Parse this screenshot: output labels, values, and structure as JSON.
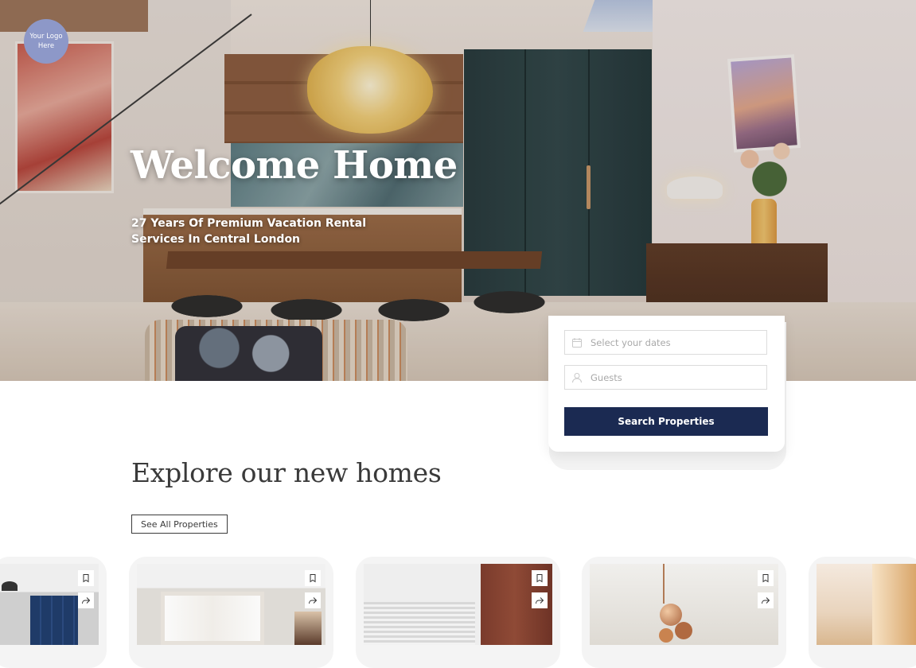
{
  "logo": {
    "line1": "Your Logo",
    "line2": "Here"
  },
  "hero": {
    "title": "Welcome Home",
    "subtitle": "27 Years Of Premium Vacation Rental Services In Central London"
  },
  "search": {
    "dates_placeholder": "Select your dates",
    "guests_placeholder": "Guests",
    "button_label": "Search Properties",
    "button_color": "#1b2a52"
  },
  "explore": {
    "title": "Explore our new homes",
    "see_all_label": "See All Properties"
  },
  "cards": [
    {
      "icons": [
        "bookmark-icon",
        "share-icon"
      ]
    },
    {
      "icons": [
        "bookmark-icon",
        "share-icon"
      ]
    },
    {
      "icons": [
        "bookmark-icon",
        "share-icon"
      ]
    },
    {
      "icons": [
        "bookmark-icon",
        "share-icon"
      ]
    },
    {
      "icons": []
    }
  ],
  "colors": {
    "logo_bg": "#8d98c8",
    "primary": "#1b2a52",
    "text_dark": "#3a3a3a"
  }
}
